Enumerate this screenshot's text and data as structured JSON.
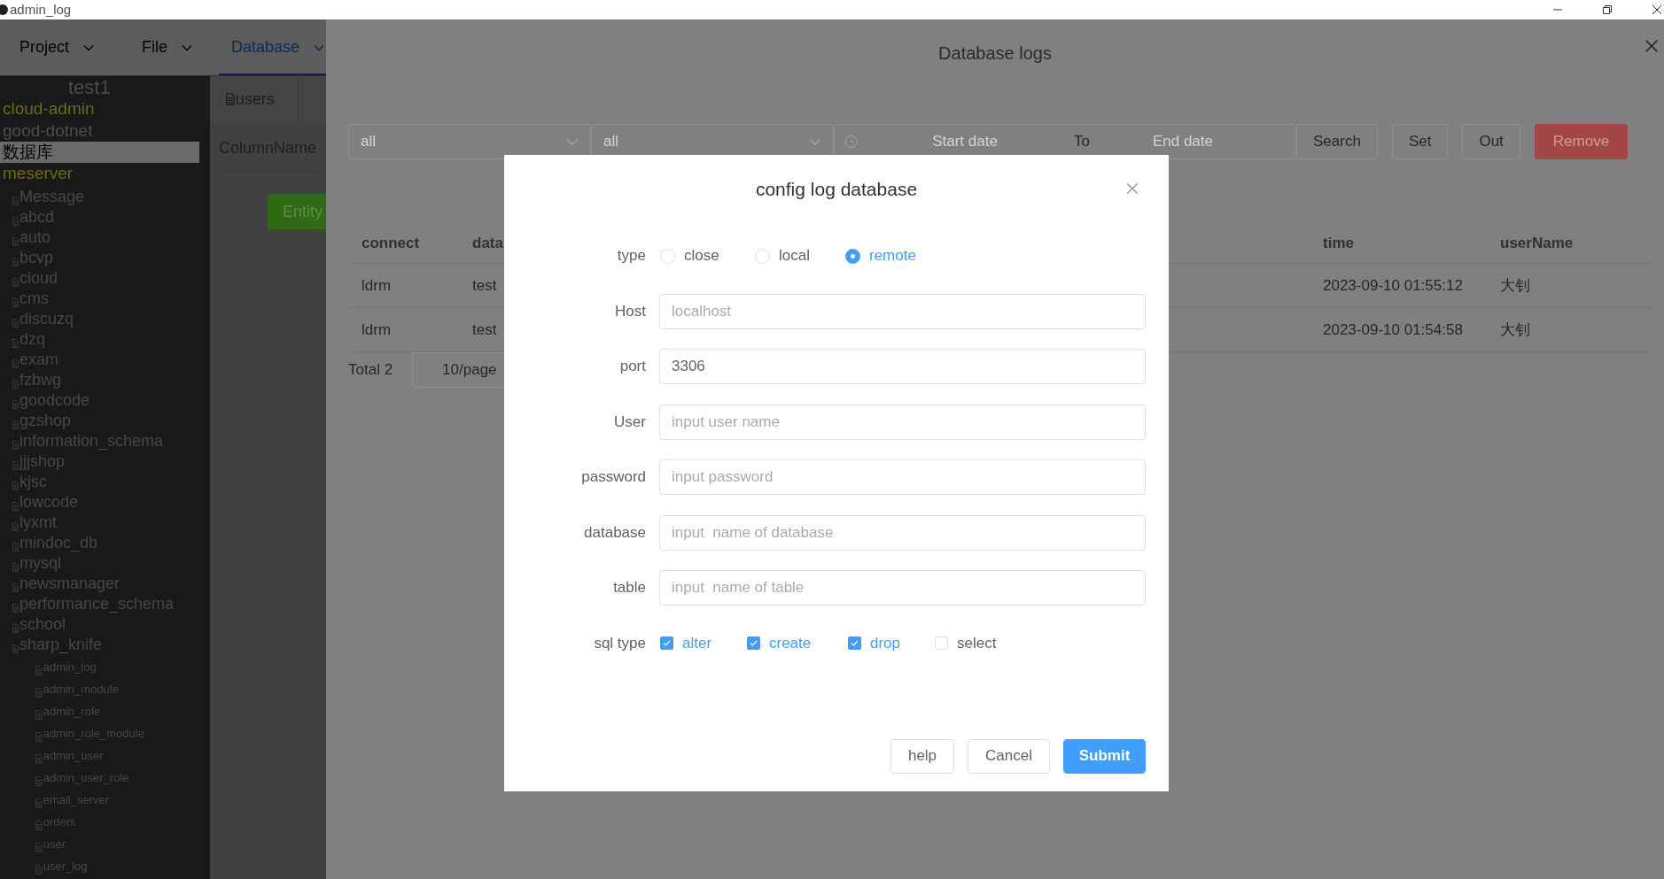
{
  "window": {
    "title": "admin_log"
  },
  "menu": [
    {
      "label": "Project",
      "selected": false
    },
    {
      "label": "File",
      "selected": false
    },
    {
      "label": "Database",
      "selected": true
    }
  ],
  "sidebar": {
    "title": "test1",
    "items": [
      {
        "label": "cloud-admin",
        "color": "#6b6b12",
        "selected": false
      },
      {
        "label": "good-dotnet",
        "color": "#4d4d4d",
        "selected": false
      },
      {
        "label": "数据库",
        "color": "#000000",
        "selected": true
      },
      {
        "label": "meserver",
        "color": "#6b6b12",
        "selected": false,
        "children": [
          {
            "label": "Message"
          },
          {
            "label": "abcd"
          },
          {
            "label": "auto"
          },
          {
            "label": "bcvp"
          },
          {
            "label": "cloud"
          },
          {
            "label": "cms"
          },
          {
            "label": "discuzq"
          },
          {
            "label": "dzq"
          },
          {
            "label": "exam"
          },
          {
            "label": "fzbwg"
          },
          {
            "label": "goodcode"
          },
          {
            "label": "gzshop"
          },
          {
            "label": "information_schema"
          },
          {
            "label": "jjjshop"
          },
          {
            "label": "kjsc"
          },
          {
            "label": "lowcode"
          },
          {
            "label": "lyxmt"
          },
          {
            "label": "mindoc_db"
          },
          {
            "label": "mysql"
          },
          {
            "label": "newsmanager"
          },
          {
            "label": "performance_schema"
          },
          {
            "label": "school"
          },
          {
            "label": "sharp_knife",
            "children": [
              {
                "label": "admin_log"
              },
              {
                "label": "admin_module"
              },
              {
                "label": "admin_role"
              },
              {
                "label": "admin_role_module"
              },
              {
                "label": "admin_user"
              },
              {
                "label": "admin_user_role"
              },
              {
                "label": "email_server"
              },
              {
                "label": "orders"
              },
              {
                "label": "user"
              },
              {
                "label": "user_log"
              }
            ]
          }
        ]
      }
    ]
  },
  "editor": {
    "tab": "users",
    "column_header": "ColumnName",
    "entity_button": "Entity"
  },
  "drawer": {
    "title": "Database logs",
    "filters": [
      {
        "placeholder": "all"
      },
      {
        "placeholder": "all"
      }
    ],
    "date_range": {
      "start_placeholder": "Start date",
      "separator": "To",
      "end_placeholder": "End date"
    },
    "buttons": [
      {
        "label": "Search",
        "kind": "default"
      },
      {
        "label": "Set",
        "kind": "default"
      },
      {
        "label": "Out",
        "kind": "default"
      },
      {
        "label": "Remove",
        "kind": "danger"
      }
    ],
    "table": {
      "columns": [
        "connect",
        "data",
        "time",
        "userName"
      ],
      "rows": [
        [
          "ldrm",
          "test",
          "2023-09-10 01:55:12",
          "大钊"
        ],
        [
          "ldrm",
          "test",
          "2023-09-10 01:54:58",
          "大钊"
        ]
      ]
    },
    "pagination": {
      "total": "Total 2",
      "page_size": "10/page"
    }
  },
  "dialog": {
    "title": "config log database",
    "type": {
      "label": "type",
      "options": [
        {
          "label": "close",
          "selected": false
        },
        {
          "label": "local",
          "selected": false
        },
        {
          "label": "remote",
          "selected": true
        }
      ]
    },
    "fields": [
      {
        "label": "Host",
        "placeholder": "localhost"
      },
      {
        "label": "port",
        "value": "3306"
      },
      {
        "label": "User",
        "placeholder": "input user name"
      },
      {
        "label": "password",
        "placeholder": "input password"
      },
      {
        "label": "database",
        "placeholder": "input  name of database"
      },
      {
        "label": "table",
        "placeholder": "input  name of table"
      }
    ],
    "sql_type": {
      "label": "sql type",
      "options": [
        {
          "label": "alter",
          "checked": true
        },
        {
          "label": "create",
          "checked": true
        },
        {
          "label": "drop",
          "checked": true
        },
        {
          "label": "select",
          "checked": false
        }
      ]
    },
    "buttons": [
      {
        "label": "help",
        "kind": "default"
      },
      {
        "label": "Cancel",
        "kind": "default"
      },
      {
        "label": "Submit",
        "kind": "primary"
      }
    ]
  }
}
